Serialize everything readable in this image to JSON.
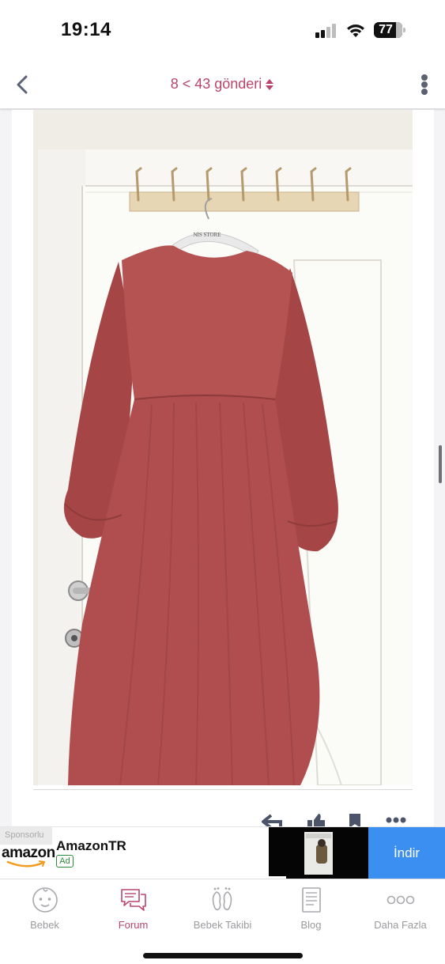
{
  "status_bar": {
    "time": "19:14",
    "battery": "77"
  },
  "nav": {
    "title": "8 < 43 gönderi"
  },
  "ad": {
    "sponsor_label": "Sponsorlu",
    "logo_text": "amazon",
    "advertiser": "AmazonTR",
    "badge": "Ad",
    "cta": "İndir"
  },
  "tabs": [
    {
      "label": "Bebek",
      "icon": "baby-face-icon",
      "active": false
    },
    {
      "label": "Forum",
      "icon": "chat-bubbles-icon",
      "active": true
    },
    {
      "label": "Bebek Takibi",
      "icon": "footprints-icon",
      "active": false
    },
    {
      "label": "Blog",
      "icon": "document-icon",
      "active": false
    },
    {
      "label": "Daha Fazla",
      "icon": "more-dots-icon",
      "active": false
    }
  ],
  "post": {
    "image_subject": "dress-photo",
    "hanger_text": "NİS STORE",
    "actions": [
      "reply-icon",
      "like-icon",
      "bookmark-icon",
      "more-icon"
    ]
  },
  "colors": {
    "accent": "#b9466a",
    "install_button": "#3b8ff0",
    "dress": "#b04e4f"
  }
}
